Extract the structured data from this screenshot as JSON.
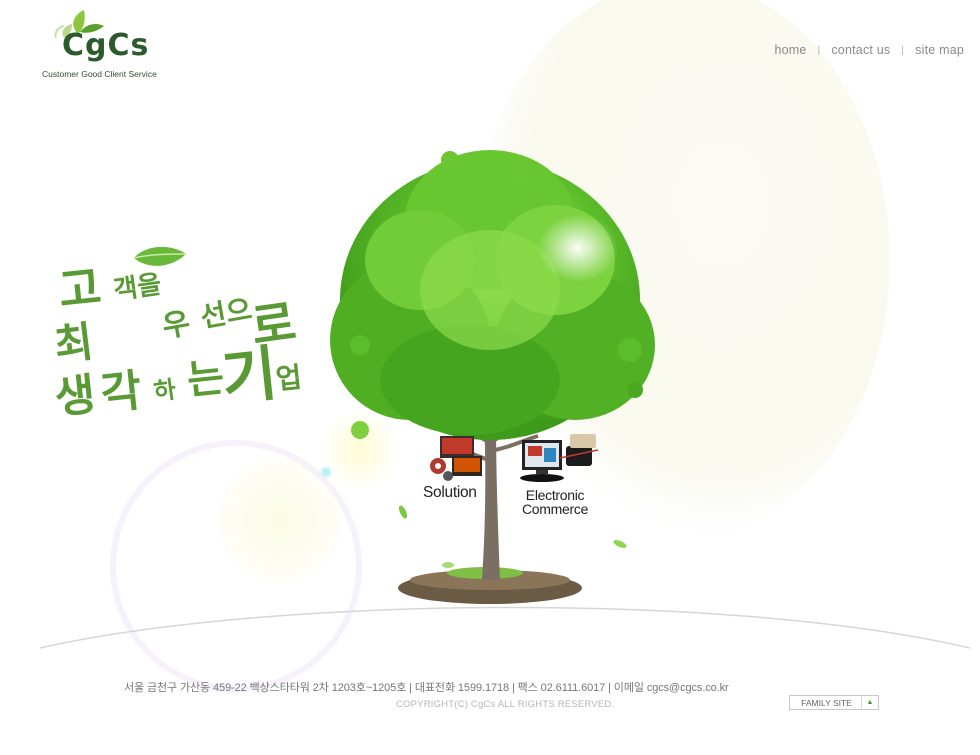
{
  "brand": {
    "logo_text": "CgCs",
    "tagline": "Customer Good Client Service"
  },
  "top_nav": {
    "items": [
      "home",
      "contact us",
      "site map"
    ],
    "separator": "|"
  },
  "slogan": {
    "parts": [
      "고",
      "객을",
      "최",
      "우",
      "선으",
      "로",
      "생",
      "각",
      "하",
      "는",
      "기",
      "업"
    ]
  },
  "products": {
    "solution_label": "Solution",
    "ecommerce_line1": "Electronic",
    "ecommerce_line2": "Commerce"
  },
  "footer": {
    "address": "서울 금천구 가산동 459-22 백상스타타워 2차 1203호~1205호 | 대표전화 1599.1718 | 팩스 02.6111.6017 | 이메일 cgcs@cgcs.co.kr",
    "copyright": "COPYRIGHT(C) CgCs ALL RIGHTS RESERVED.",
    "family_site_label": "FAMILY SITE"
  },
  "icons": {
    "logo": "leaf-logo-icon",
    "family_site_toggle": "triangle-up-icon"
  },
  "colors": {
    "brand_green": "#5a9a34",
    "logo_dark_green": "#2b5a2b",
    "nav_gray": "#8a8a8a",
    "footer_gray": "#777777"
  }
}
